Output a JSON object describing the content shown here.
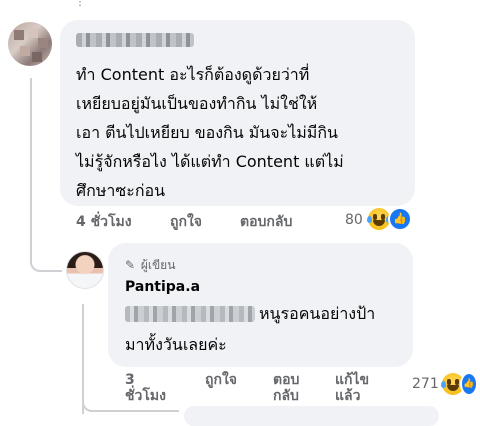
{
  "comment": {
    "text": "ทำ Content อะไรก็ต้องดูด้วยว่าที่\nเหยียบอยู่มันเป็นของทำกิน ไม่ใช่ให้\nเอา ตีนไปเหยียบ ของกิน มันจะไม่มีกิน\nไม่รู้จักหรือไง ได้แต่ทำ Content แต่ไม่\nศึกษาซะก่อน",
    "time": "4 ชั่วโมง",
    "like_label": "ถูกใจ",
    "reply_label": "ตอบกลับ",
    "reaction_count": "80"
  },
  "reply": {
    "author_badge": "ผู้เขียน",
    "author_name": "Pantipa.a",
    "text_line1": "หนูรอคนอย่างป้า",
    "text_line2": "มาทั้งวันเลยค่ะ",
    "time": "3 ชั่วโมง",
    "like_label": "ถูกใจ",
    "reply_label": "ตอบ กลับ",
    "edited_label": "แก้ไข แล้ว",
    "reaction_count": "271"
  },
  "icons": {
    "pen": "pencil-icon",
    "haha": "haha-reaction-icon",
    "like": "like-reaction-icon"
  },
  "colors": {
    "bubble": "#f0f2f5",
    "secondary_text": "#65676b",
    "like_blue": "#1877f2"
  }
}
